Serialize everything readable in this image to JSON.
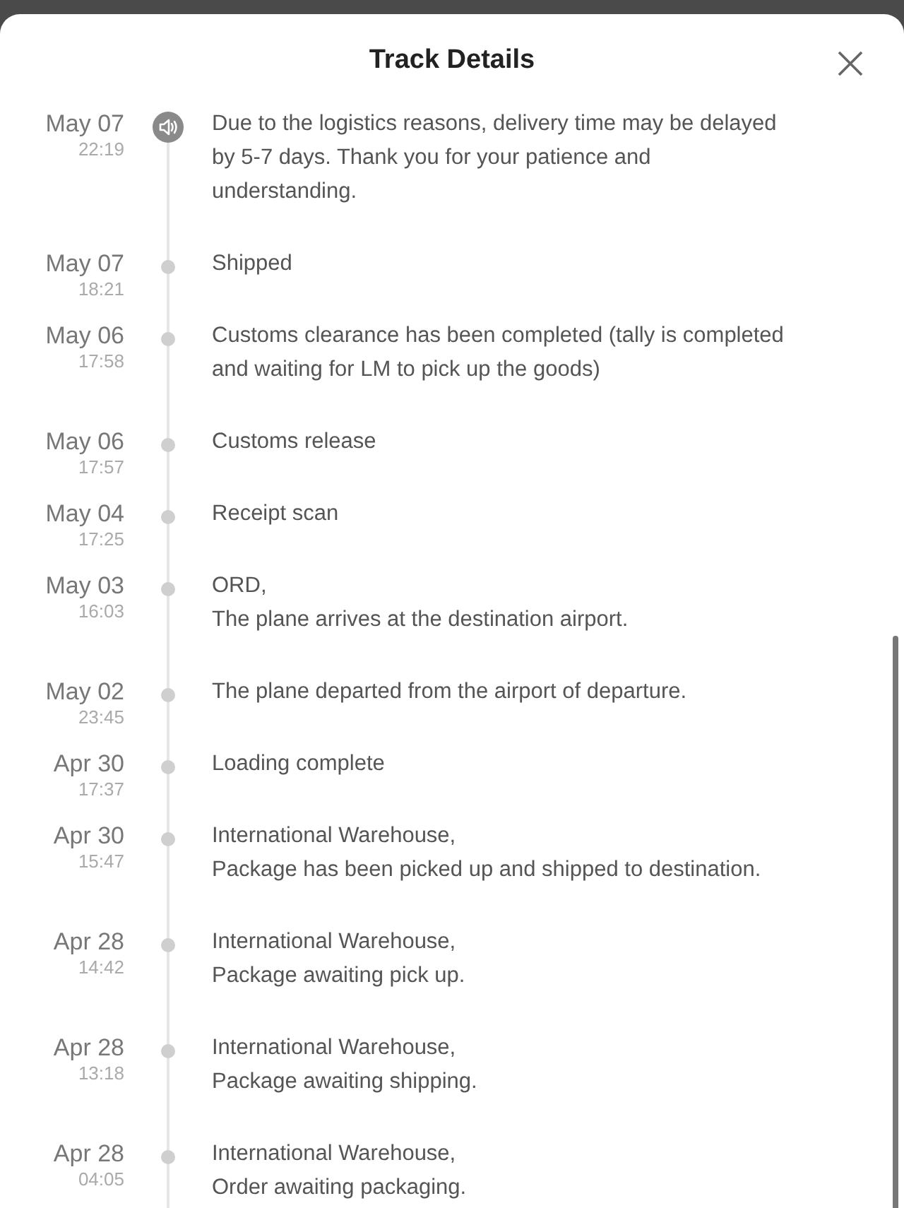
{
  "title": "Track Details",
  "events": [
    {
      "kind": "notice",
      "date": "May 07",
      "time": "22:19",
      "text": "Due to the logistics reasons, delivery time may be delayed\nby 5-7 days. Thank you for your patience and\nunderstanding."
    },
    {
      "kind": "event",
      "date": "May 07",
      "time": "18:21",
      "text": "Shipped"
    },
    {
      "kind": "event",
      "date": "May 06",
      "time": "17:58",
      "text": "Customs clearance has been completed (tally is completed\nand waiting for LM to pick up the goods)"
    },
    {
      "kind": "event",
      "date": "May 06",
      "time": "17:57",
      "text": "Customs release"
    },
    {
      "kind": "event",
      "date": "May 04",
      "time": "17:25",
      "text": "Receipt scan"
    },
    {
      "kind": "event",
      "date": "May 03",
      "time": "16:03",
      "text": "ORD,\nThe plane arrives at the destination airport."
    },
    {
      "kind": "event",
      "date": "May 02",
      "time": "23:45",
      "text": "The plane departed from the airport of departure."
    },
    {
      "kind": "event",
      "date": "Apr 30",
      "time": "17:37",
      "text": "Loading complete"
    },
    {
      "kind": "event",
      "date": "Apr 30",
      "time": "15:47",
      "text": "International Warehouse,\nPackage has been picked up and shipped to destination."
    },
    {
      "kind": "event",
      "date": "Apr 28",
      "time": "14:42",
      "text": "International Warehouse,\nPackage awaiting pick up."
    },
    {
      "kind": "event",
      "date": "Apr 28",
      "time": "13:18",
      "text": "International Warehouse,\nPackage awaiting shipping."
    },
    {
      "kind": "event",
      "date": "Apr 28",
      "time": "04:05",
      "text": "International Warehouse,\nOrder awaiting packaging."
    }
  ]
}
